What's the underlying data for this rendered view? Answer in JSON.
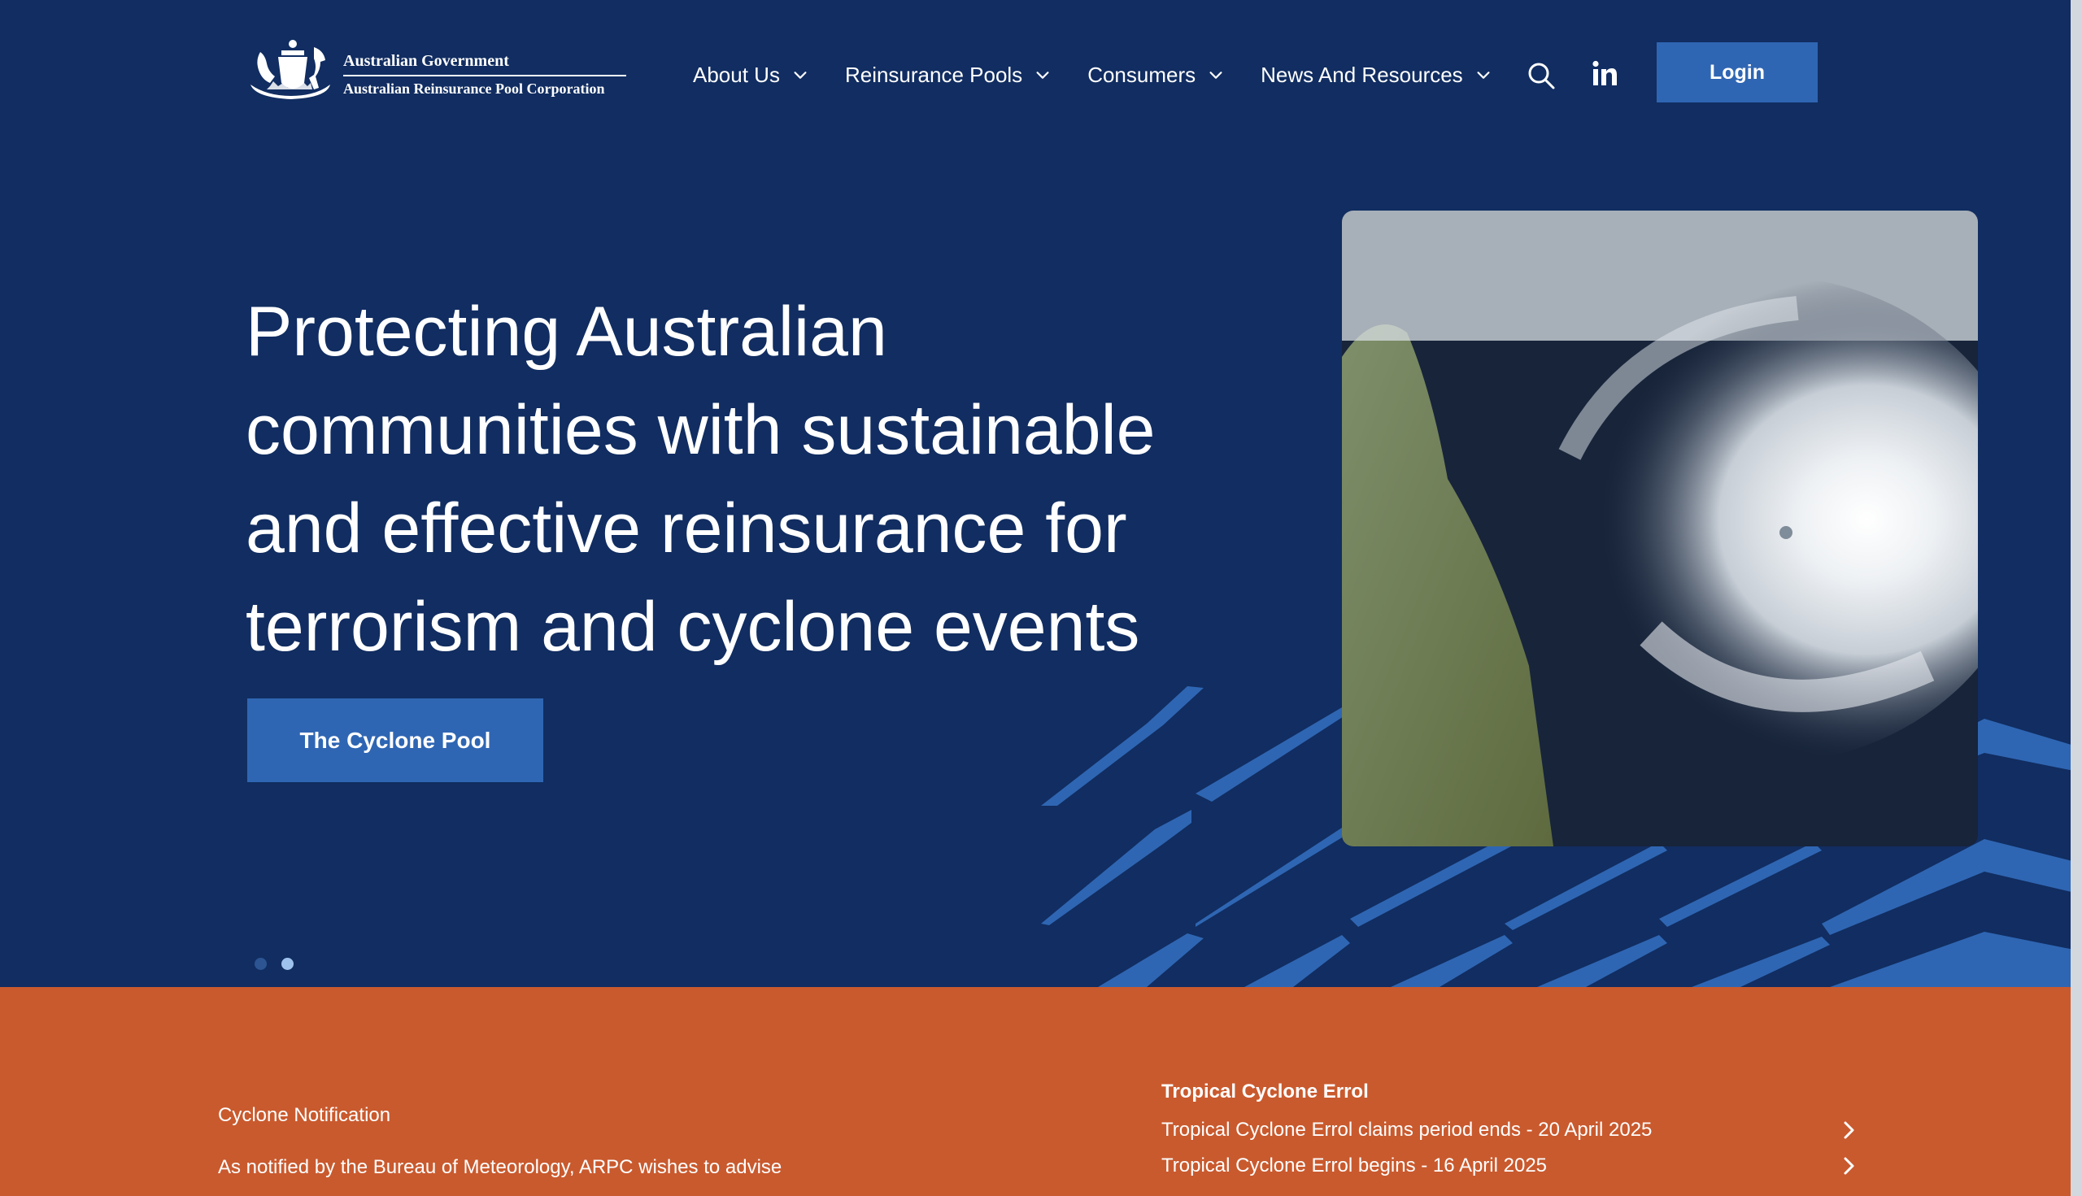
{
  "header": {
    "logo": {
      "line1": "Australian Government",
      "line2": "Australian Reinsurance Pool Corporation",
      "crest_icon": "coat-of-arms"
    },
    "nav": [
      {
        "label": "About Us",
        "icon": "chevron-down-icon"
      },
      {
        "label": "Reinsurance Pools",
        "icon": "chevron-down-icon"
      },
      {
        "label": "Consumers",
        "icon": "chevron-down-icon"
      },
      {
        "label": "News And Resources",
        "icon": "chevron-down-icon"
      }
    ],
    "search_icon": "search-icon",
    "linkedin_icon": "linkedin-icon",
    "login_label": "Login"
  },
  "hero": {
    "title": "Protecting Australian communities with sustainable and effective reinsurance for terrorism and cyclone events",
    "cta_label": "The Cyclone Pool",
    "slides_total": 2,
    "active_slide": 2
  },
  "notice": {
    "label": "Cyclone Notification",
    "text": "As notified by the Bureau of Meteorology, ARPC wishes to advise",
    "events_title": "Tropical Cyclone Errol",
    "events": [
      {
        "label": "Tropical Cyclone Errol claims period ends - 20 April 2025",
        "icon": "chevron-right-icon"
      },
      {
        "label": "Tropical Cyclone Errol begins - 16 April 2025",
        "icon": "chevron-right-icon"
      }
    ]
  },
  "colors": {
    "hero_bg": "#112d61",
    "accent_blue": "#2f66b3",
    "notice_orange": "#c95a2e",
    "text": "#ffffff"
  }
}
